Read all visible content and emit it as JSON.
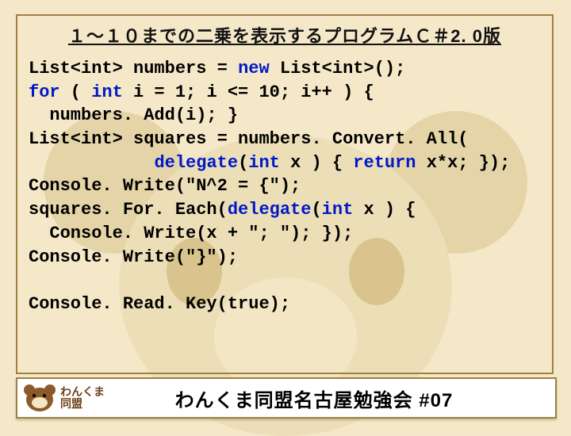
{
  "slide": {
    "title": "１～１０までの二乗を表示するプログラムＣ＃2. 0版"
  },
  "code": {
    "l1a": "List<int>",
    "l1b": " numbers = ",
    "l1c": "new",
    "l1d": " List<int>();",
    "l2a": "for",
    "l2b": " ( ",
    "l2c": "int",
    "l2d": " i = 1; i <= 10; i++ ) {",
    "l3": "  numbers. Add(i); }",
    "l4": "List<int> squares = numbers. Convert. All(",
    "l5a": "            ",
    "l5b": "delegate",
    "l5c": "(",
    "l5d": "int",
    "l5e": " x ) { ",
    "l5f": "return",
    "l5g": " x*x; });",
    "l6": "Console. Write(\"N^2 = {\");",
    "l7a": "squares. For. Each(",
    "l7b": "delegate",
    "l7c": "(",
    "l7d": "int",
    "l7e": " x ) {",
    "l8": "  Console. Write(x + \"; \"); });",
    "l9": "Console. Write(\"}\");",
    "blank": "",
    "l10": "Console. Read. Key(true);"
  },
  "footer": {
    "logo_line1": "わんくま",
    "logo_line2": "同盟",
    "text": "わんくま同盟名古屋勉強会 #07"
  }
}
